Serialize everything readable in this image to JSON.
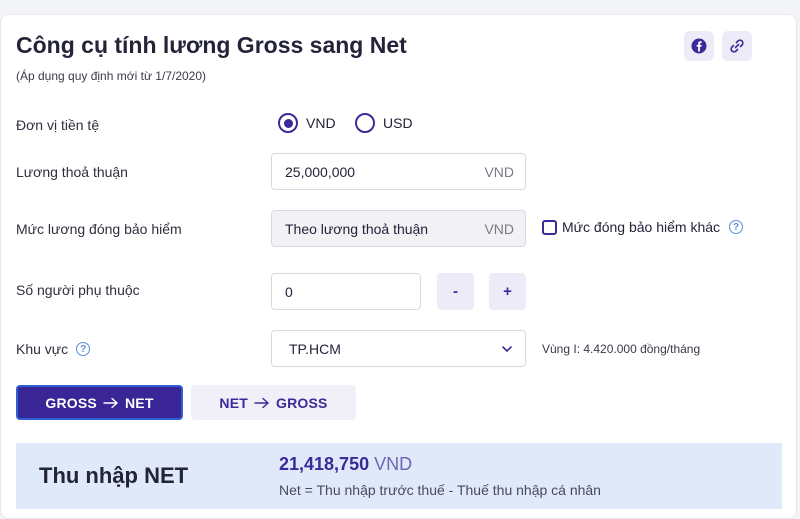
{
  "header": {
    "title": "Công cụ tính lương Gross sang Net",
    "subtitle": "(Áp dụng quy định mới từ 1/7/2020)",
    "share_icons": [
      "facebook-icon",
      "link-icon"
    ]
  },
  "currency": {
    "label": "Đơn vị tiền tệ",
    "options": [
      "VND",
      "USD"
    ],
    "selected": "VND"
  },
  "salary": {
    "label": "Lương thoả thuận",
    "value": "25,000,000",
    "unit": "VND"
  },
  "insurance": {
    "label": "Mức lương đóng bảo hiểm",
    "value": "Theo lương thoả thuận",
    "unit": "VND",
    "other_label": "Mức đóng bảo hiểm khác",
    "other_checked": false
  },
  "dependents": {
    "label": "Số người phụ thuộc",
    "value": "0",
    "minus": "-",
    "plus": "+"
  },
  "region": {
    "label": "Khu vực",
    "selected": "TP.HCM",
    "note": "Vùng I: 4.420.000 đồng/tháng"
  },
  "tabs": {
    "gross_net": {
      "left": "GROSS",
      "right": "NET"
    },
    "net_gross": {
      "left": "NET",
      "right": "GROSS"
    },
    "active": "gross_net"
  },
  "result": {
    "label": "Thu nhập NET",
    "value": "21,418,750",
    "unit": "VND",
    "formula": "Net = Thu nhập trước thuế - Thuế thu nhập cá nhân"
  },
  "colors": {
    "accent": "#3b2a99",
    "result_bg": "#dfe9f9"
  }
}
